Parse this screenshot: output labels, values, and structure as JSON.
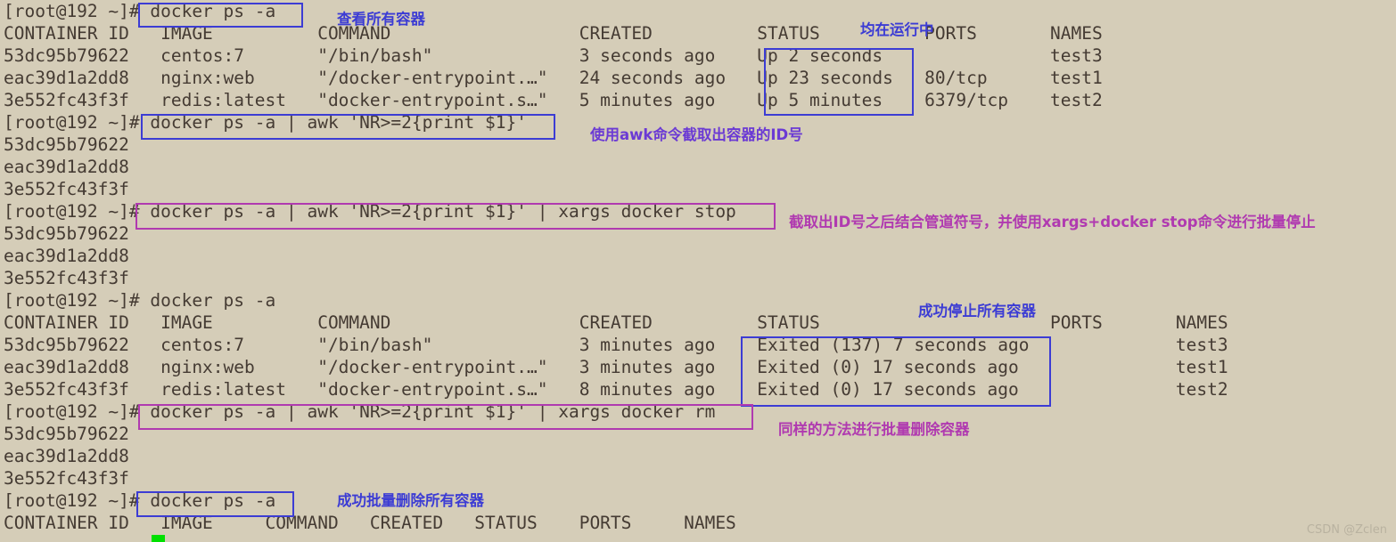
{
  "terminal": {
    "prompt": "[root@192 ~]# ",
    "background_color": "#d5cdb8",
    "text_color": "#453b33",
    "cursor_color": "#00e000",
    "lines": [
      "[root@192 ~]# docker ps -a",
      "CONTAINER ID   IMAGE          COMMAND                  CREATED          STATUS          PORTS       NAMES",
      "53dc95b79622   centos:7       \"/bin/bash\"              3 seconds ago    Up 2 seconds                test3",
      "eac39d1a2dd8   nginx:web      \"/docker-entrypoint.…\"   24 seconds ago   Up 23 seconds   80/tcp      test1",
      "3e552fc43f3f   redis:latest   \"docker-entrypoint.s…\"   5 minutes ago    Up 5 minutes    6379/tcp    test2",
      "[root@192 ~]# docker ps -a | awk 'NR>=2{print $1}'",
      "53dc95b79622",
      "eac39d1a2dd8",
      "3e552fc43f3f",
      "[root@192 ~]# docker ps -a | awk 'NR>=2{print $1}' | xargs docker stop",
      "53dc95b79622",
      "eac39d1a2dd8",
      "3e552fc43f3f",
      "[root@192 ~]# docker ps -a",
      "CONTAINER ID   IMAGE          COMMAND                  CREATED          STATUS                      PORTS       NAMES",
      "53dc95b79622   centos:7       \"/bin/bash\"              3 minutes ago    Exited (137) 7 seconds ago              test3",
      "eac39d1a2dd8   nginx:web      \"/docker-entrypoint.…\"   3 minutes ago    Exited (0) 17 seconds ago               test1",
      "3e552fc43f3f   redis:latest   \"docker-entrypoint.s…\"   8 minutes ago    Exited (0) 17 seconds ago               test2",
      "[root@192 ~]# docker ps -a | awk 'NR>=2{print $1}' | xargs docker rm",
      "53dc95b79622",
      "eac39d1a2dd8",
      "3e552fc43f3f",
      "[root@192 ~]# docker ps -a",
      "CONTAINER ID   IMAGE     COMMAND   CREATED   STATUS    PORTS     NAMES"
    ]
  },
  "annotations": {
    "notes": [
      {
        "text": "查看所有容器",
        "color": "#3c3cd4"
      },
      {
        "text": "均在运行中",
        "color": "#3c3cd4"
      },
      {
        "text": "使用awk命令截取出容器的ID号",
        "color": "#6b3ad4"
      },
      {
        "text": "截取出ID号之后结合管道符号，并使用xargs+docker stop命令进行批量停止",
        "color": "#b03ab0"
      },
      {
        "text": "成功停止所有容器",
        "color": "#3c3cd4"
      },
      {
        "text": "同样的方法进行批量删除容器",
        "color": "#b03ab0"
      },
      {
        "text": "成功批量删除所有容器",
        "color": "#3c3cd4"
      }
    ],
    "box_colors": {
      "blue": "#3c3cd4",
      "purple": "#b03ab0"
    }
  },
  "watermark": "CSDN @Zclen"
}
